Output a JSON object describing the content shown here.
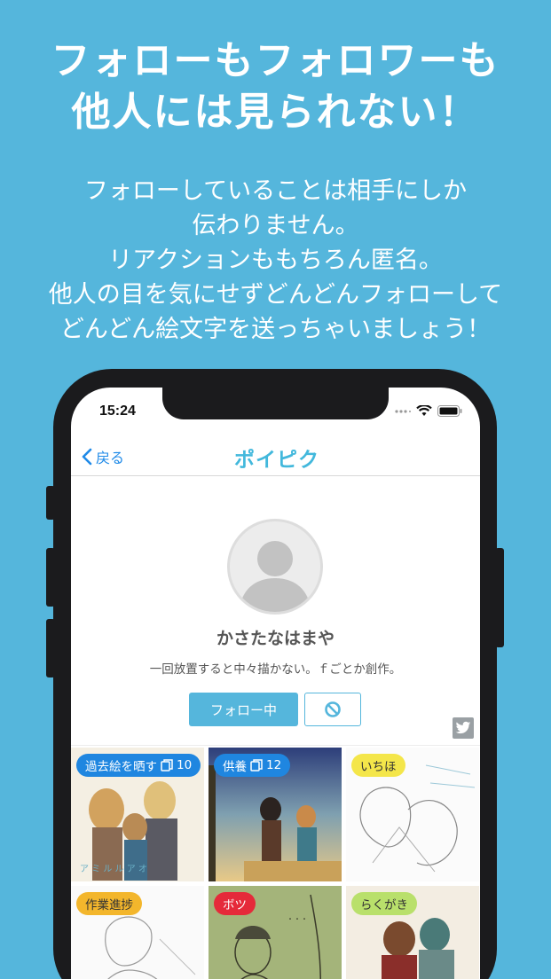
{
  "headline": {
    "line1": "フォローもフォロワーも",
    "line2": "他人には見られない！"
  },
  "subtext": {
    "line1": "フォローしていることは相手にしか",
    "line2": "伝わりません。",
    "line3": "リアクションももちろん匿名。",
    "line4": "他人の目を気にせずどんどんフォローして",
    "line5": "どんどん絵文字を送っちゃいましょう！"
  },
  "status": {
    "time": "15:24"
  },
  "navbar": {
    "back_label": "戻る",
    "logo": "ポイピク"
  },
  "profile": {
    "name": "かさたなはまや",
    "bio": "一回放置すると中々描かない。ｆごとか創作。",
    "follow_label": "フォロー中"
  },
  "tiles": [
    {
      "tag": "過去絵を晒す",
      "count": "10",
      "tag_color": "blue"
    },
    {
      "tag": "供養",
      "count": "12",
      "tag_color": "blue"
    },
    {
      "tag": "いちほ",
      "count": "",
      "tag_color": "yellow"
    },
    {
      "tag": "作業進捗",
      "count": "",
      "tag_color": "orange"
    },
    {
      "tag": "ボツ",
      "count": "",
      "tag_color": "red"
    },
    {
      "tag": "らくがき",
      "count": "",
      "tag_color": "green"
    }
  ],
  "colors": {
    "background": "#55b6dc",
    "accent": "#55b6dc",
    "link": "#1f8ae8"
  }
}
